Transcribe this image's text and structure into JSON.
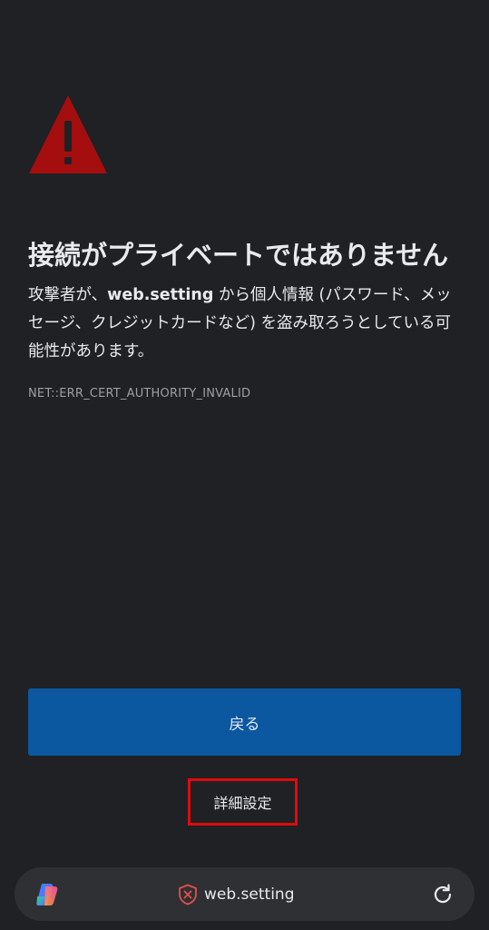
{
  "warning": {
    "icon": "warning-triangle-icon",
    "icon_color": "#a50e0e"
  },
  "title": "接続がプライベートではありません",
  "description": {
    "prefix": "攻撃者が、",
    "host": "web.setting",
    "suffix": " から個人情報 (パスワード、メッセージ、クレジットカードなど) を盗み取ろうとしている可能性があります。"
  },
  "error_code": "NET::ERR_CERT_AUTHORITY_INVALID",
  "buttons": {
    "back_label": "戻る",
    "back_color": "#0b57a0",
    "advanced_label": "詳細設定",
    "highlight_color": "#e00b0b"
  },
  "address_bar": {
    "left_icon": "copilot-icon",
    "security_icon": "not-secure-shield-icon",
    "url": "web.setting",
    "right_icon": "reload-icon"
  }
}
